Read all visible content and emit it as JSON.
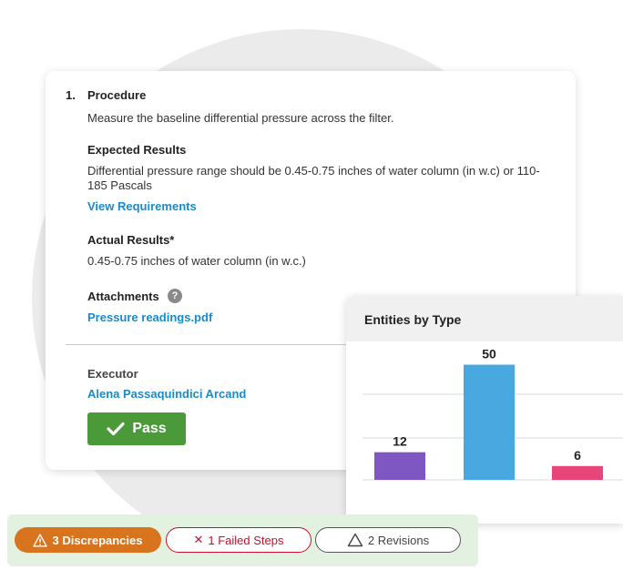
{
  "procedure": {
    "step_number": "1.",
    "title": "Procedure",
    "text": "Measure the baseline differential pressure across the filter."
  },
  "expected": {
    "title": "Expected Results",
    "text": "Differential pressure range should be 0.45-0.75 inches of water column (in w.c) or 110-185 Pascals",
    "link": "View Requirements"
  },
  "actual": {
    "title": "Actual Results*",
    "text": "0.45-0.75 inches of water column (in w.c.)"
  },
  "attachments": {
    "title": "Attachments",
    "help_glyph": "?",
    "file": "Pressure readings.pdf"
  },
  "executor": {
    "label": "Executor",
    "name": "Alena Passaquindici Arcand"
  },
  "pass_button": {
    "label": "Pass",
    "color": "#4a9a3a"
  },
  "status": {
    "discrepancies": "3 Discrepancies",
    "failed_steps": "1 Failed Steps",
    "revisions": "2 Revisions"
  },
  "chart_data": {
    "type": "bar",
    "title": "Entities by Type",
    "categories": [
      "",
      "",
      ""
    ],
    "values": [
      12,
      50,
      6
    ],
    "colors": [
      "#7e57c2",
      "#4aa8e0",
      "#e8457a"
    ],
    "grid": true
  }
}
